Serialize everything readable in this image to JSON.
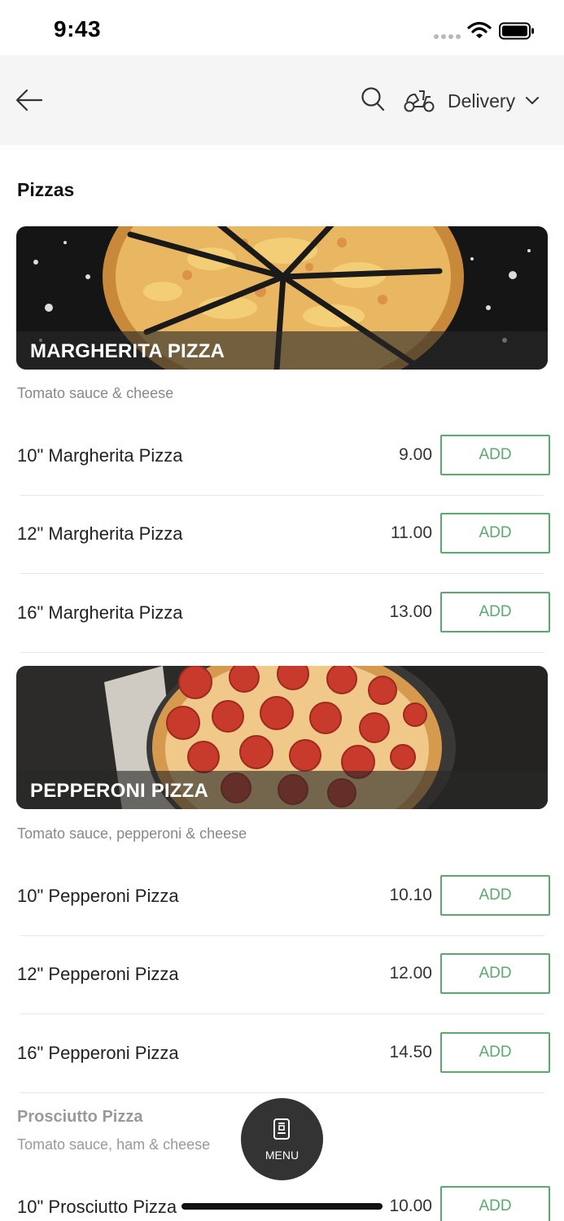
{
  "status_bar": {
    "time": "9:43"
  },
  "header": {
    "back_icon": "arrow-left-icon",
    "search_icon": "search-icon",
    "delivery_icon": "scooter-icon",
    "delivery_label": "Delivery",
    "dropdown_icon": "chevron-down-icon"
  },
  "section": {
    "title": "Pizzas"
  },
  "groups": [
    {
      "banner_title": "MARGHERITA PIZZA",
      "description": "Tomato sauce & cheese",
      "items": [
        {
          "name": "10\" Margherita Pizza",
          "price": "9.00",
          "add": "ADD"
        },
        {
          "name": "12\" Margherita Pizza",
          "price": "11.00",
          "add": "ADD"
        },
        {
          "name": "16\" Margherita Pizza",
          "price": "13.00",
          "add": "ADD"
        }
      ]
    },
    {
      "banner_title": "PEPPERONI PIZZA",
      "description": "Tomato sauce, pepperoni & cheese",
      "items": [
        {
          "name": "10\" Pepperoni Pizza",
          "price": "10.10",
          "add": "ADD"
        },
        {
          "name": "12\" Pepperoni Pizza",
          "price": "12.00",
          "add": "ADD"
        },
        {
          "name": "16\" Pepperoni Pizza",
          "price": "14.50",
          "add": "ADD"
        }
      ]
    },
    {
      "title": "Prosciutto Pizza",
      "description": "Tomato sauce, ham & cheese",
      "items": [
        {
          "name": "10\" Prosciutto Pizza",
          "price": "10.00",
          "add": "ADD"
        }
      ]
    }
  ],
  "fab": {
    "label": "MENU",
    "icon": "menu-book-icon"
  },
  "colors": {
    "accent": "#5aaa6e",
    "header_bg": "#f5f5f5",
    "fab_bg": "#333333"
  }
}
